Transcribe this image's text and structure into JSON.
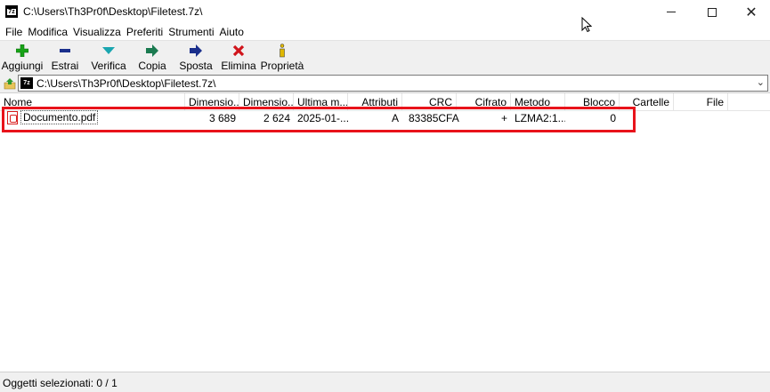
{
  "window": {
    "title": "C:\\Users\\Th3Pr0f\\Desktop\\Filetest.7z\\",
    "app_icon": "7z",
    "close_glyph": "✕"
  },
  "menu": [
    "File",
    "Modifica",
    "Visualizza",
    "Preferiti",
    "Strumenti",
    "Aiuto"
  ],
  "toolbar": {
    "add": "Aggiungi",
    "extract": "Estrai",
    "test": "Verifica",
    "copy": "Copia",
    "move": "Sposta",
    "delete": "Elimina",
    "info": "Proprietà"
  },
  "address": {
    "path": "C:\\Users\\Th3Pr0f\\Desktop\\Filetest.7z\\",
    "chevron": "⌄"
  },
  "columns": [
    "Nome",
    "Dimensio...",
    "Dimensio...",
    "Ultima m...",
    "Attributi",
    "CRC",
    "Cifrato",
    "Metodo",
    "Blocco",
    "Cartelle",
    "File"
  ],
  "rows": [
    {
      "name": "Documento.pdf",
      "size": "3 689",
      "packed": "2 624",
      "modified": "2025-01-...",
      "attributes": "A",
      "crc": "83385CFA",
      "encrypted": "+",
      "method": "LZMA2:1...",
      "block": "0"
    }
  ],
  "status": {
    "text": "Oggetti selezionati: 0 / 1"
  },
  "colors": {
    "highlight": "#e8131b",
    "toolbar_bg": "#f0f0f0",
    "add_green": "#17a317",
    "extract_blue": "#1a2f8c",
    "test_teal": "#1aa6b0",
    "delete_red": "#d0141b",
    "info_yellow": "#e0b800"
  }
}
